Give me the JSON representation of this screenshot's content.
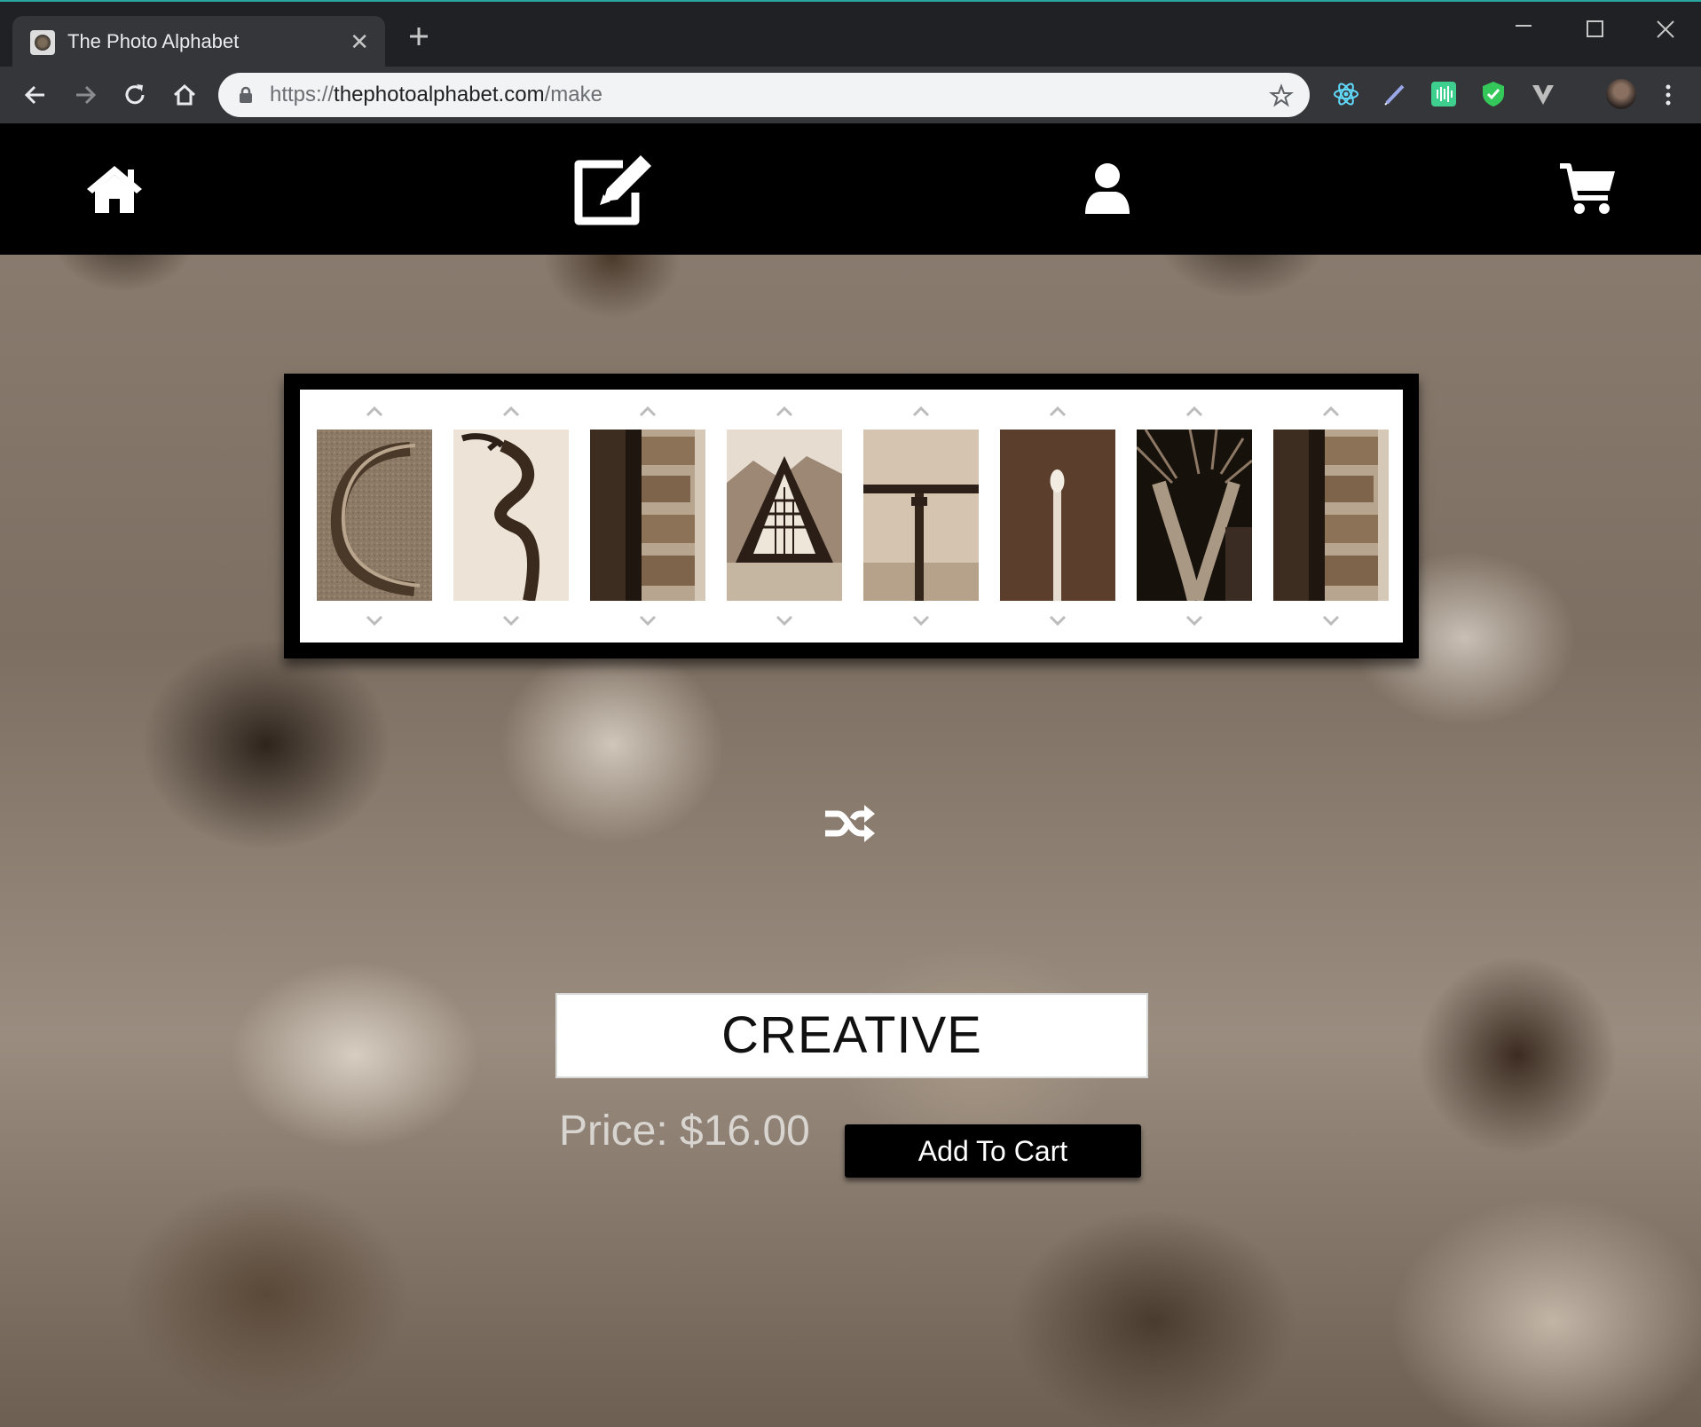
{
  "browser": {
    "tab_title": "The Photo Alphabet",
    "url_scheme": "https://",
    "url_host": "thephotoalphabet.com",
    "url_path": "/make"
  },
  "site_nav": {
    "items": [
      "home-icon",
      "edit-icon",
      "user-icon",
      "cart-icon"
    ]
  },
  "frame": {
    "letters": [
      "C",
      "R",
      "E",
      "A",
      "T",
      "I",
      "V",
      "E"
    ]
  },
  "builder": {
    "word_value": "CREATIVE",
    "price_text": "Price: $16.00",
    "add_to_cart_label": "Add To Cart"
  },
  "colors": {
    "sepia_dark": "#3b2a1e",
    "sepia_mid": "#8a6a50",
    "sepia_light": "#d9c8b4",
    "nav_bg": "#000000",
    "chrome_bg": "#202124"
  }
}
